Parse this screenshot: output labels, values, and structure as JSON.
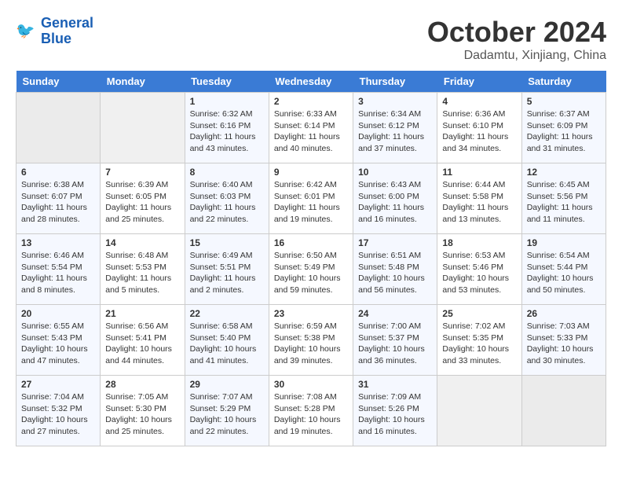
{
  "header": {
    "logo_line1": "General",
    "logo_line2": "Blue",
    "month": "October 2024",
    "location": "Dadamtu, Xinjiang, China"
  },
  "weekdays": [
    "Sunday",
    "Monday",
    "Tuesday",
    "Wednesday",
    "Thursday",
    "Friday",
    "Saturday"
  ],
  "weeks": [
    [
      {
        "day": "",
        "sunrise": "",
        "sunset": "",
        "daylight": ""
      },
      {
        "day": "",
        "sunrise": "",
        "sunset": "",
        "daylight": ""
      },
      {
        "day": "1",
        "sunrise": "Sunrise: 6:32 AM",
        "sunset": "Sunset: 6:16 PM",
        "daylight": "Daylight: 11 hours and 43 minutes."
      },
      {
        "day": "2",
        "sunrise": "Sunrise: 6:33 AM",
        "sunset": "Sunset: 6:14 PM",
        "daylight": "Daylight: 11 hours and 40 minutes."
      },
      {
        "day": "3",
        "sunrise": "Sunrise: 6:34 AM",
        "sunset": "Sunset: 6:12 PM",
        "daylight": "Daylight: 11 hours and 37 minutes."
      },
      {
        "day": "4",
        "sunrise": "Sunrise: 6:36 AM",
        "sunset": "Sunset: 6:10 PM",
        "daylight": "Daylight: 11 hours and 34 minutes."
      },
      {
        "day": "5",
        "sunrise": "Sunrise: 6:37 AM",
        "sunset": "Sunset: 6:09 PM",
        "daylight": "Daylight: 11 hours and 31 minutes."
      }
    ],
    [
      {
        "day": "6",
        "sunrise": "Sunrise: 6:38 AM",
        "sunset": "Sunset: 6:07 PM",
        "daylight": "Daylight: 11 hours and 28 minutes."
      },
      {
        "day": "7",
        "sunrise": "Sunrise: 6:39 AM",
        "sunset": "Sunset: 6:05 PM",
        "daylight": "Daylight: 11 hours and 25 minutes."
      },
      {
        "day": "8",
        "sunrise": "Sunrise: 6:40 AM",
        "sunset": "Sunset: 6:03 PM",
        "daylight": "Daylight: 11 hours and 22 minutes."
      },
      {
        "day": "9",
        "sunrise": "Sunrise: 6:42 AM",
        "sunset": "Sunset: 6:01 PM",
        "daylight": "Daylight: 11 hours and 19 minutes."
      },
      {
        "day": "10",
        "sunrise": "Sunrise: 6:43 AM",
        "sunset": "Sunset: 6:00 PM",
        "daylight": "Daylight: 11 hours and 16 minutes."
      },
      {
        "day": "11",
        "sunrise": "Sunrise: 6:44 AM",
        "sunset": "Sunset: 5:58 PM",
        "daylight": "Daylight: 11 hours and 13 minutes."
      },
      {
        "day": "12",
        "sunrise": "Sunrise: 6:45 AM",
        "sunset": "Sunset: 5:56 PM",
        "daylight": "Daylight: 11 hours and 11 minutes."
      }
    ],
    [
      {
        "day": "13",
        "sunrise": "Sunrise: 6:46 AM",
        "sunset": "Sunset: 5:54 PM",
        "daylight": "Daylight: 11 hours and 8 minutes."
      },
      {
        "day": "14",
        "sunrise": "Sunrise: 6:48 AM",
        "sunset": "Sunset: 5:53 PM",
        "daylight": "Daylight: 11 hours and 5 minutes."
      },
      {
        "day": "15",
        "sunrise": "Sunrise: 6:49 AM",
        "sunset": "Sunset: 5:51 PM",
        "daylight": "Daylight: 11 hours and 2 minutes."
      },
      {
        "day": "16",
        "sunrise": "Sunrise: 6:50 AM",
        "sunset": "Sunset: 5:49 PM",
        "daylight": "Daylight: 10 hours and 59 minutes."
      },
      {
        "day": "17",
        "sunrise": "Sunrise: 6:51 AM",
        "sunset": "Sunset: 5:48 PM",
        "daylight": "Daylight: 10 hours and 56 minutes."
      },
      {
        "day": "18",
        "sunrise": "Sunrise: 6:53 AM",
        "sunset": "Sunset: 5:46 PM",
        "daylight": "Daylight: 10 hours and 53 minutes."
      },
      {
        "day": "19",
        "sunrise": "Sunrise: 6:54 AM",
        "sunset": "Sunset: 5:44 PM",
        "daylight": "Daylight: 10 hours and 50 minutes."
      }
    ],
    [
      {
        "day": "20",
        "sunrise": "Sunrise: 6:55 AM",
        "sunset": "Sunset: 5:43 PM",
        "daylight": "Daylight: 10 hours and 47 minutes."
      },
      {
        "day": "21",
        "sunrise": "Sunrise: 6:56 AM",
        "sunset": "Sunset: 5:41 PM",
        "daylight": "Daylight: 10 hours and 44 minutes."
      },
      {
        "day": "22",
        "sunrise": "Sunrise: 6:58 AM",
        "sunset": "Sunset: 5:40 PM",
        "daylight": "Daylight: 10 hours and 41 minutes."
      },
      {
        "day": "23",
        "sunrise": "Sunrise: 6:59 AM",
        "sunset": "Sunset: 5:38 PM",
        "daylight": "Daylight: 10 hours and 39 minutes."
      },
      {
        "day": "24",
        "sunrise": "Sunrise: 7:00 AM",
        "sunset": "Sunset: 5:37 PM",
        "daylight": "Daylight: 10 hours and 36 minutes."
      },
      {
        "day": "25",
        "sunrise": "Sunrise: 7:02 AM",
        "sunset": "Sunset: 5:35 PM",
        "daylight": "Daylight: 10 hours and 33 minutes."
      },
      {
        "day": "26",
        "sunrise": "Sunrise: 7:03 AM",
        "sunset": "Sunset: 5:33 PM",
        "daylight": "Daylight: 10 hours and 30 minutes."
      }
    ],
    [
      {
        "day": "27",
        "sunrise": "Sunrise: 7:04 AM",
        "sunset": "Sunset: 5:32 PM",
        "daylight": "Daylight: 10 hours and 27 minutes."
      },
      {
        "day": "28",
        "sunrise": "Sunrise: 7:05 AM",
        "sunset": "Sunset: 5:30 PM",
        "daylight": "Daylight: 10 hours and 25 minutes."
      },
      {
        "day": "29",
        "sunrise": "Sunrise: 7:07 AM",
        "sunset": "Sunset: 5:29 PM",
        "daylight": "Daylight: 10 hours and 22 minutes."
      },
      {
        "day": "30",
        "sunrise": "Sunrise: 7:08 AM",
        "sunset": "Sunset: 5:28 PM",
        "daylight": "Daylight: 10 hours and 19 minutes."
      },
      {
        "day": "31",
        "sunrise": "Sunrise: 7:09 AM",
        "sunset": "Sunset: 5:26 PM",
        "daylight": "Daylight: 10 hours and 16 minutes."
      },
      {
        "day": "",
        "sunrise": "",
        "sunset": "",
        "daylight": ""
      },
      {
        "day": "",
        "sunrise": "",
        "sunset": "",
        "daylight": ""
      }
    ]
  ]
}
